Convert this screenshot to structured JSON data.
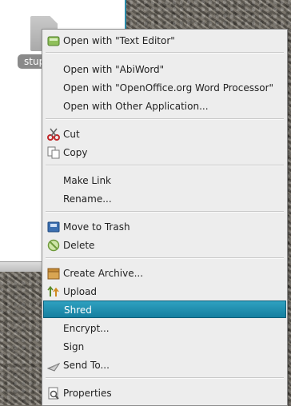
{
  "file": {
    "name": "stup"
  },
  "menu": {
    "items": [
      {
        "id": "open-text-editor",
        "label": "Open with \"Text Editor\"",
        "icon": "text-editor-icon"
      },
      {
        "id": "open-abiword",
        "label": "Open with \"AbiWord\"",
        "icon": ""
      },
      {
        "id": "open-openoffice",
        "label": "Open with \"OpenOffice.org Word Processor\"",
        "icon": ""
      },
      {
        "id": "open-other",
        "label": "Open with Other Application...",
        "icon": ""
      },
      {
        "id": "cut",
        "label": "Cut",
        "icon": "scissors-icon"
      },
      {
        "id": "copy",
        "label": "Copy",
        "icon": "copy-icon"
      },
      {
        "id": "make-link",
        "label": "Make Link",
        "icon": ""
      },
      {
        "id": "rename",
        "label": "Rename...",
        "icon": ""
      },
      {
        "id": "move-to-trash",
        "label": "Move to Trash",
        "icon": "trash-icon"
      },
      {
        "id": "delete",
        "label": "Delete",
        "icon": "delete-icon"
      },
      {
        "id": "create-archive",
        "label": "Create Archive...",
        "icon": "archive-icon"
      },
      {
        "id": "upload",
        "label": "Upload",
        "icon": "upload-icon"
      },
      {
        "id": "shred",
        "label": "Shred",
        "icon": "",
        "selected": true
      },
      {
        "id": "encrypt",
        "label": "Encrypt...",
        "icon": ""
      },
      {
        "id": "sign",
        "label": "Sign",
        "icon": ""
      },
      {
        "id": "send-to",
        "label": "Send To...",
        "icon": "send-to-icon"
      },
      {
        "id": "properties",
        "label": "Properties",
        "icon": "properties-icon"
      }
    ]
  },
  "colors": {
    "selection": "#1e8fb0",
    "window_border": "#2a8aa8"
  }
}
